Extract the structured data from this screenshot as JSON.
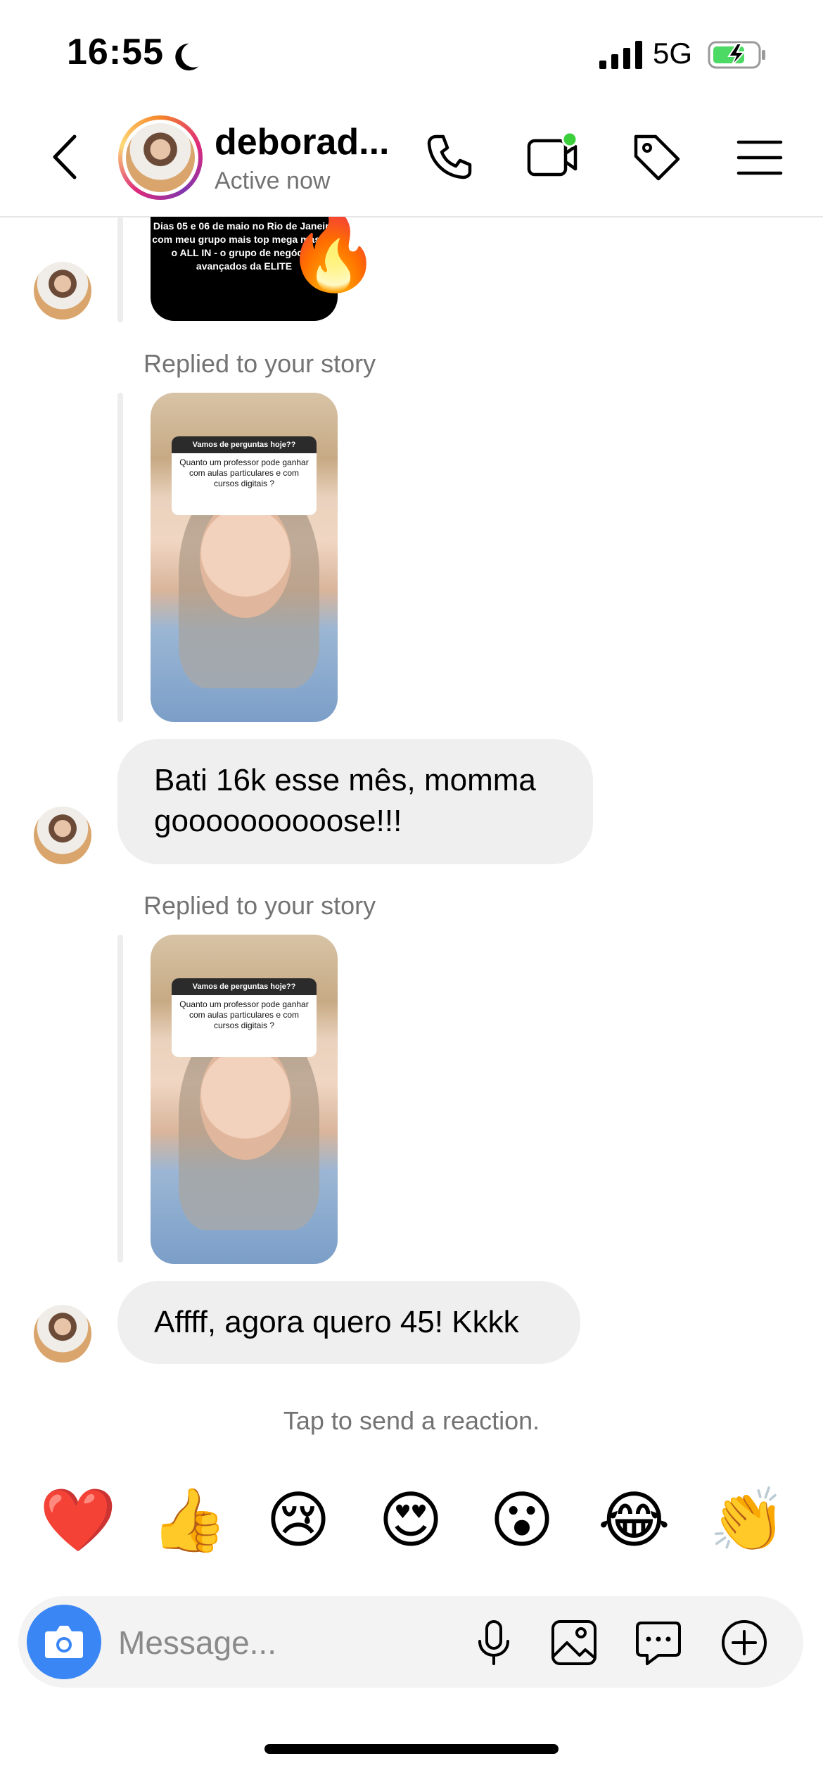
{
  "status": {
    "time": "16:55",
    "network": "5G"
  },
  "header": {
    "username": "deborad...",
    "status": "Active now"
  },
  "messages": {
    "story1_text": "Dias 05 e 06 de maio no Rio de Janeiro com meu grupo mais top mega master: o ALL IN - o grupo de negócios avançados da ELITE",
    "replied_label_1": "Replied to your story",
    "story_card_title": "Vamos de perguntas hoje??",
    "story_card_question": "Quanto um professor pode ganhar com aulas particulares e com cursos digitais ?",
    "bubble1": "Bati 16k esse mês, momma goooooooooose!!!",
    "replied_label_2": "Replied to your story",
    "bubble2": "Affff, agora quero 45! Kkkk"
  },
  "reactions": {
    "prompt": "Tap to send a reaction.",
    "items": [
      "❤️",
      "👍",
      "😢",
      "😍",
      "😮",
      "😂",
      "👏"
    ]
  },
  "composer": {
    "placeholder": "Message..."
  },
  "colors": {
    "accent": "#3a86f5",
    "online_dot": "#3ccf3c",
    "bubble": "#efefef"
  }
}
